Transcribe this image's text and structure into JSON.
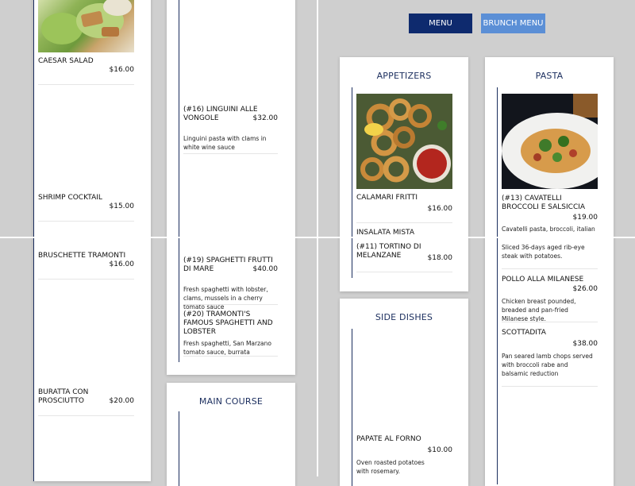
{
  "buttons": {
    "menu": "MENU",
    "brunch": "BRUNCH MENU"
  },
  "col1": {
    "items": [
      {
        "name": "CAESAR SALAD",
        "price": "$16.00"
      },
      {
        "name": "SHRIMP COCKTAIL",
        "price": "$15.00"
      },
      {
        "name": "BRUSCHETTE TRAMONTI",
        "price": "$16.00"
      },
      {
        "name": "BURATTA CON PROSCIUTTO",
        "price": "$20.00"
      }
    ]
  },
  "col2": {
    "items": [
      {
        "name": "(#16) LINGUINI ALLE VONGOLE",
        "price": "$32.00",
        "desc": "Linguini pasta with clams in white wine sauce"
      },
      {
        "name": "(#19) SPAGHETTI FRUTTI DI MARE",
        "price": "$40.00",
        "desc": "Fresh spaghetti with lobster, clams, mussels in a cherry tomato sauce"
      },
      {
        "name": "(#20) TRAMONTI'S FAMOUS SPAGHETTI AND LOBSTER",
        "desc": "Fresh spaghetti, San Marzano tomato sauce, burrata"
      }
    ],
    "main_course_title": "MAIN COURSE"
  },
  "appetizers": {
    "title": "APPETIZERS",
    "items": [
      {
        "name": "CALAMARI FRITTI",
        "price": "$16.00"
      },
      {
        "name": "INSALATA MISTA"
      },
      {
        "name": "(#11) TORTINO DI MELANZANE",
        "price": "$18.00"
      }
    ]
  },
  "side_dishes": {
    "title": "SIDE DISHES",
    "items": [
      {
        "name": "PAPATE AL FORNO",
        "price": "$10.00",
        "desc": "Oven roasted potatoes with rosemary."
      }
    ]
  },
  "pasta": {
    "title": "PASTA",
    "items": [
      {
        "name": "(#13) CAVATELLI BROCCOLI E SALSICCIA",
        "price": "$19.00",
        "desc": "Cavatelli pasta, broccoli, italian"
      },
      {
        "desc": "Sliced 36-days aged rib-eye steak with potatoes."
      },
      {
        "name": "POLLO ALLA MILANESE",
        "price": "$26.00",
        "desc": "Chicken breast pounded, breaded and pan-fried Milanese style."
      },
      {
        "name": "SCOTTADITA",
        "price": "$38.00",
        "desc": "Pan seared lamb chops served with broccoli rabe and balsamic reduction"
      }
    ]
  },
  "colors": {
    "navy": "#0e2a6e",
    "light_blue": "#5b8fd6"
  }
}
